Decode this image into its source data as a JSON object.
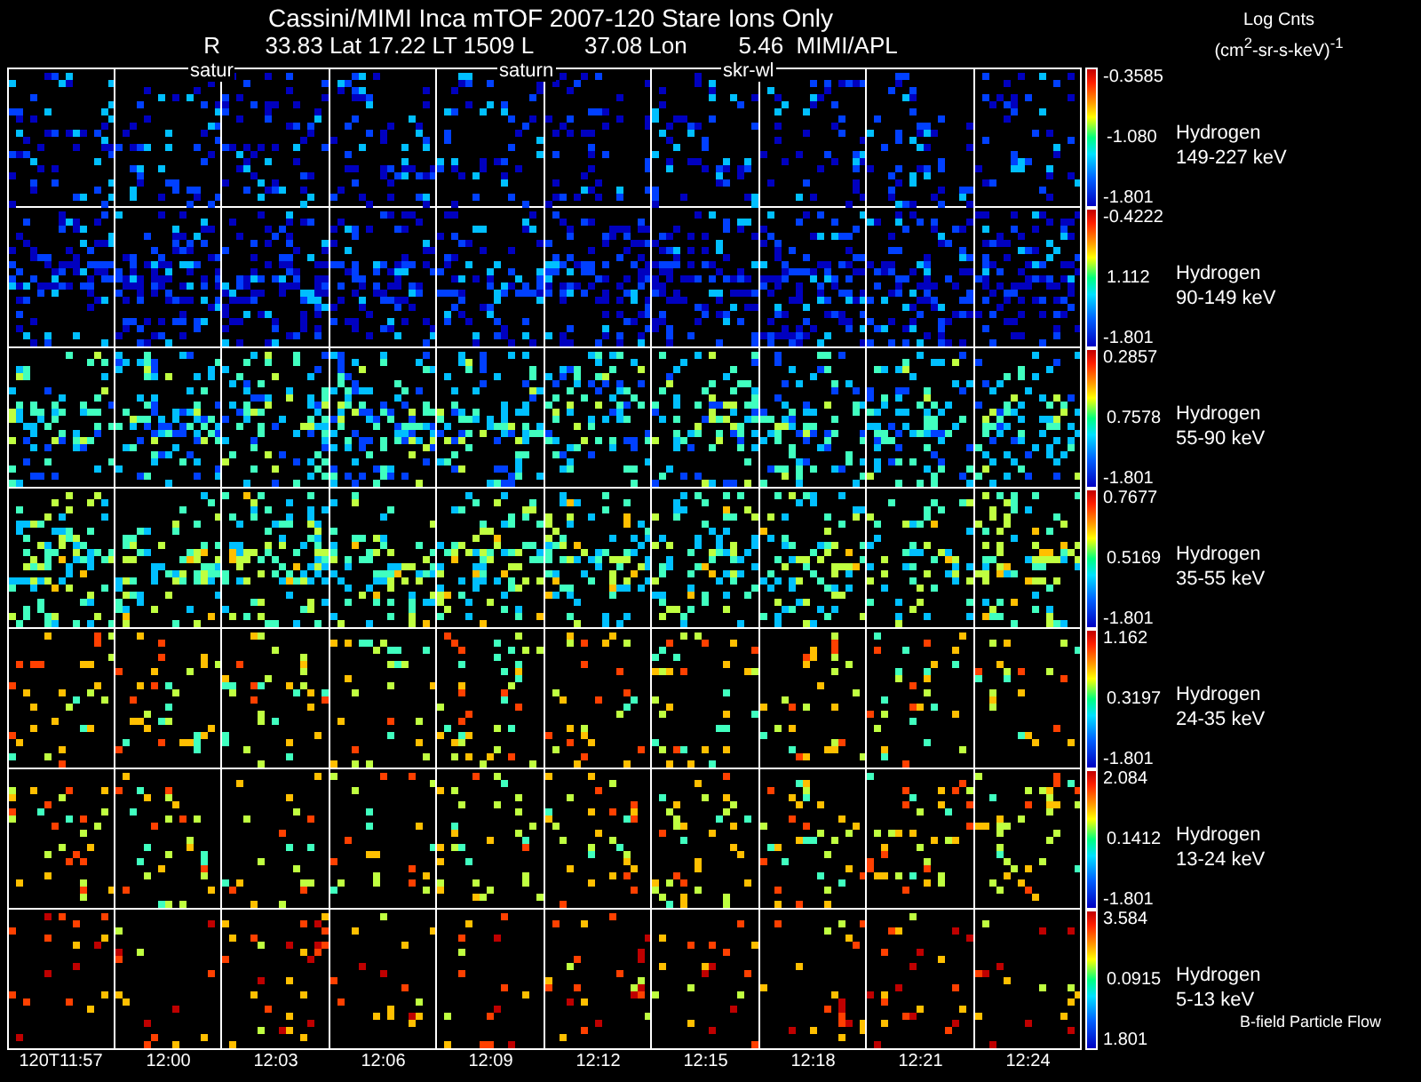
{
  "title": "Cassini/MIMI Inca mTOF  2007-120   Stare   Ions Only",
  "info_line": "R       33.83 Lat 17.22 LT 1509 L        37.08 Lon        5.46  MIMI/APL",
  "units": {
    "label": "Log Cnts",
    "unit": "(cm$^{2}$-sr-s-keV)$^{-1}$"
  },
  "overlay_labels": [
    "satur",
    "saturn",
    "skr-wl"
  ],
  "panels": [
    {
      "species": "Hydrogen",
      "energy": "149-227 keV",
      "scale_max": "-0.3585",
      "scale_mid": "-1.080",
      "scale_min": "-1.801"
    },
    {
      "species": "Hydrogen",
      "energy": "90-149 keV",
      "scale_max": "-0.4222",
      "scale_mid": "1.112",
      "scale_min": "-1.801"
    },
    {
      "species": "Hydrogen",
      "energy": "55-90 keV",
      "scale_max": "0.2857",
      "scale_mid": "0.7578",
      "scale_min": "-1.801"
    },
    {
      "species": "Hydrogen",
      "energy": "35-55 keV",
      "scale_max": "0.7677",
      "scale_mid": "0.5169",
      "scale_min": "-1.801"
    },
    {
      "species": "Hydrogen",
      "energy": "24-35 keV",
      "scale_max": "1.162",
      "scale_mid": "0.3197",
      "scale_min": "-1.801"
    },
    {
      "species": "Hydrogen",
      "energy": "13-24 keV",
      "scale_max": "2.084",
      "scale_mid": "0.1412",
      "scale_min": "-1.801"
    },
    {
      "species": "Hydrogen",
      "energy": "5-13 keV",
      "scale_max": "3.584",
      "scale_mid": "0.0915",
      "scale_min": "1.801"
    }
  ],
  "footer_note": "B-field Particle Flow",
  "time_ticks": [
    "120T11:57",
    "12:00",
    "12:03",
    "12:06",
    "12:09",
    "12:12",
    "12:15",
    "12:18",
    "12:21",
    "12:24"
  ]
}
